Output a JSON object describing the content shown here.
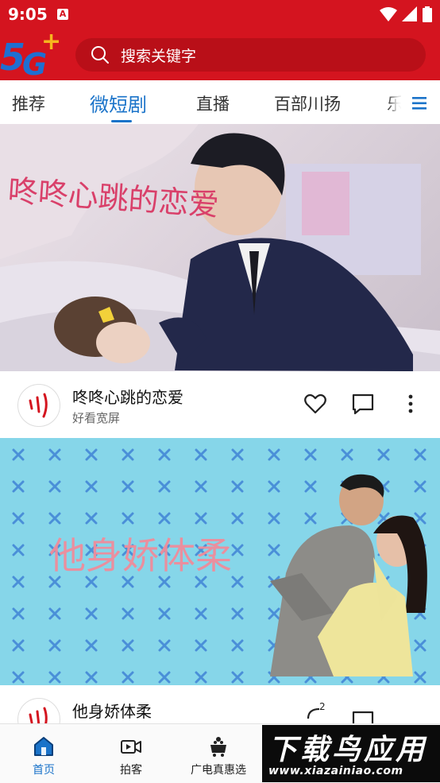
{
  "status_bar": {
    "time": "9:05",
    "notification_icon": "A"
  },
  "header": {
    "logo_text": "5G+",
    "search_placeholder": "搜索关键字"
  },
  "tabs": [
    {
      "label": "推荐",
      "active": false
    },
    {
      "label": "微短剧",
      "active": true
    },
    {
      "label": "直播",
      "active": false
    },
    {
      "label": "百部川扬",
      "active": false
    },
    {
      "label": "乐",
      "active": false
    }
  ],
  "feed": [
    {
      "poster_title": "咚咚心跳的恋爱",
      "title": "咚咚心跳的恋爱",
      "source": "好看宽屏",
      "comment_count": ""
    },
    {
      "poster_title": "他身娇体柔",
      "title": "他身娇体柔",
      "source": "",
      "comment_count": "2"
    }
  ],
  "bottom_nav": [
    {
      "label": "首页",
      "icon": "home-icon",
      "active": true
    },
    {
      "label": "拍客",
      "icon": "video-camera-icon",
      "active": false
    },
    {
      "label": "广电真惠选",
      "icon": "shopping-cart-icon",
      "active": false
    }
  ],
  "watermark": {
    "top": "下载鸟应用",
    "bottom": "www.xiazainiao.com"
  },
  "colors": {
    "brand_red": "#d4141f",
    "accent_blue": "#1a73c9",
    "poster2_bg": "#86d6e9"
  }
}
